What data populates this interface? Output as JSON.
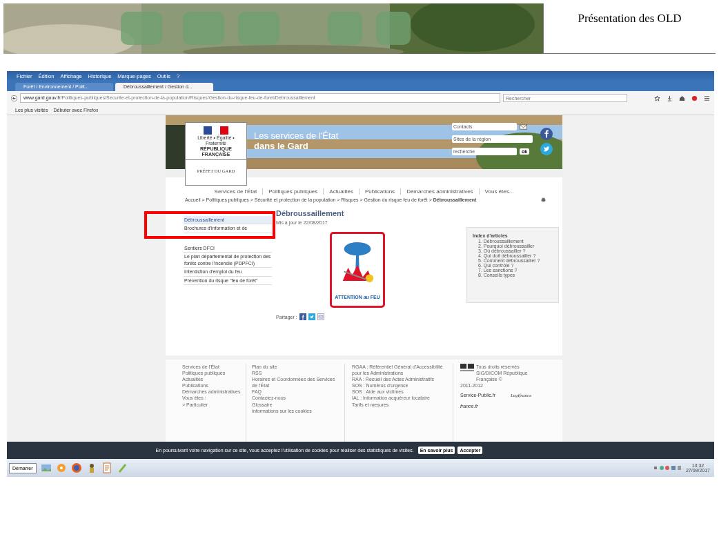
{
  "slide": {
    "title": "Présentation des OLD"
  },
  "browser": {
    "menu": [
      "Fichier",
      "Édition",
      "Affichage",
      "Historique",
      "Marque-pages",
      "Outils",
      "?"
    ],
    "tabs": [
      {
        "label": "Forêt / Environnement / Polit...",
        "selected": false
      },
      {
        "label": "Débroussaillement / Gestion d...",
        "selected": true
      }
    ],
    "url_prefix": "www.gard.gouv.fr",
    "url_rest": "/Politiques-publiques/Securite-et-protection-de-la-population/Risques/Gestion-du-risque-feu-de-foret/Debroussaillement",
    "search": {
      "placeholder": "Rechercher"
    },
    "bookmarks": [
      "Les plus visités",
      "Débuter avec Firefox"
    ]
  },
  "site": {
    "header": {
      "line1": "Les services de l'État",
      "line2": "dans le Gard",
      "motto": "Liberté • Égalité • Fraternité",
      "republic": "RÉPUBLIQUE FRANÇAISE",
      "prefect": "PRÉFET DU GARD",
      "contacts": "Contacts",
      "region": "Sites de la région",
      "search": "recherche",
      "ok": "ok"
    },
    "nav": [
      "Services de l'État",
      "Politiques publiques",
      "Actualités",
      "Publications",
      "Démarches administratives",
      "Vous êtes..."
    ],
    "breadcrumb": "Accueil > Politiques publiques > Sécurité et protection de la population > Risques > Gestion du risque feu de forêt > **Débroussaillement**",
    "side_menu": [
      {
        "label": "Débroussaillement",
        "selected": true
      },
      {
        "label": "Brochures d'information et de",
        "selected": false
      },
      {
        "label": "Sentiers DFCI",
        "selected": false
      },
      {
        "label": "Le plan départemental de protection des forêts contre l'incendie (PDPFCI)",
        "selected": false
      },
      {
        "label": "Interdiction d'emploi du feu",
        "selected": false
      },
      {
        "label": "Prévention du risque \"feu de forêt\"",
        "selected": false
      }
    ],
    "article": {
      "title": "Débroussaillement",
      "updated": "Mis à jour le 22/08/2017",
      "sign": "ATTENTION *au* FEU",
      "share": "Partager :"
    },
    "index": {
      "title": "Index d'articles",
      "items": [
        "1. Débroussaillement",
        "2. Pourquoi débroussailler",
        "3. Où débroussailler ?",
        "4. Qui doit débroussailler ?",
        "5. Comment débroussailler ?",
        "6. Qui contrôle ?",
        "7. Les sanctions ?",
        "8. Conseils types"
      ]
    },
    "footer": {
      "columns": [
        [
          "Services de l'État",
          "Politiques publiques",
          "Actualités",
          "Publications",
          "Démarches administratives",
          "Vous êtes :",
          "> Particulier"
        ],
        [
          "Plan du site",
          "RSS",
          "Horaires et Coordonnées des Services de l'État",
          "FAQ",
          "Contactez-nous",
          "Glossaire",
          "Informations sur les cookies"
        ],
        [
          "RGAA : Référentiel Général d'Accessibilité pour les Administrations",
          "RAA : Recueil des Actes Administratifs",
          "SOS : Numéros d'urgence",
          "SOS : Aide aux victimes",
          "IAL : Information acquéreur locataire",
          "Tarifs et mesures"
        ]
      ],
      "rights": "Tous droits réservés SIG/DICOM République Française ©",
      "years": "2011-2012",
      "links": [
        "Service-Public.fr",
        "Legifrance",
        "france.fr"
      ]
    }
  },
  "cookie_bar": {
    "text": "En poursuivant votre navigation sur ce site, vous acceptez l'utilisation de cookies pour réaliser des statistiques de visites.",
    "buttons": [
      "En savoir plus",
      "Accepter"
    ]
  },
  "taskbar": {
    "start": "Démarrer",
    "time": "13:32",
    "date": "27/09/2017"
  }
}
